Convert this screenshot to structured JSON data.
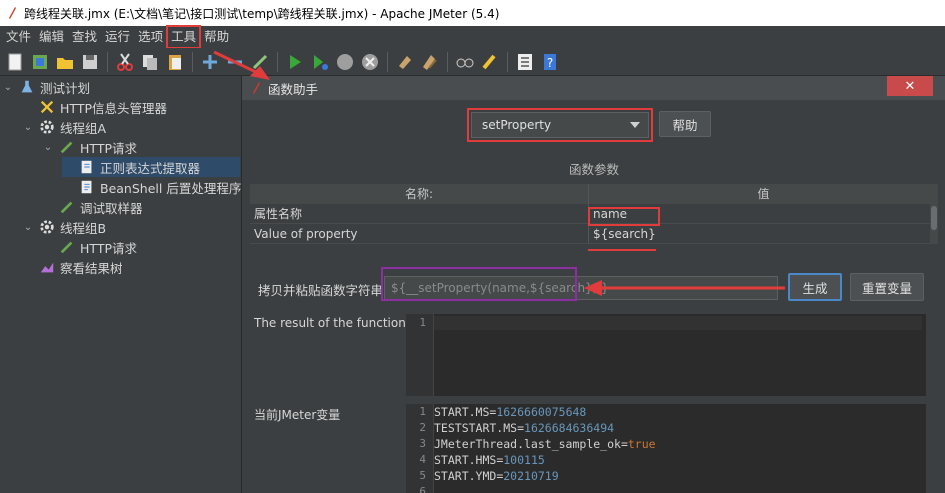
{
  "window": {
    "title": "跨线程关联.jmx (E:\\文档\\笔记\\接口测试\\temp\\跨线程关联.jmx) - Apache JMeter (5.4)"
  },
  "menu": [
    "文件",
    "编辑",
    "查找",
    "运行",
    "选项",
    "工具",
    "帮助"
  ],
  "toolbar_icons": [
    "new-icon",
    "templates-icon",
    "open-icon",
    "save-icon",
    "cut-icon",
    "copy-icon",
    "paste-icon",
    "expand-icon",
    "collapse-icon",
    "toggle-icon",
    "start-icon",
    "start-no-pause-icon",
    "stop-icon",
    "shutdown-icon",
    "clear-icon",
    "clear-all-icon",
    "search-icon",
    "reset-search-icon",
    "function-helper-icon",
    "help-icon"
  ],
  "tree": [
    {
      "label": "测试计划",
      "icon": "flask-icon",
      "level": 0,
      "expanded": true
    },
    {
      "label": "HTTP信息头管理器",
      "icon": "wrench-icon",
      "level": 1
    },
    {
      "label": "线程组A",
      "icon": "gear-icon",
      "level": 1,
      "expanded": true
    },
    {
      "label": "HTTP请求",
      "icon": "pen-icon",
      "level": 2,
      "expanded": true
    },
    {
      "label": "正则表达式提取器",
      "icon": "extractor-icon",
      "level": 3,
      "selected": true
    },
    {
      "label": "BeanShell 后置处理程序",
      "icon": "script-icon",
      "level": 3
    },
    {
      "label": "调试取样器",
      "icon": "pen-icon",
      "level": 2
    },
    {
      "label": "线程组B",
      "icon": "gear-icon",
      "level": 1,
      "expanded": true
    },
    {
      "label": "HTTP请求",
      "icon": "pen-icon",
      "level": 2
    },
    {
      "label": "察看结果树",
      "icon": "chart-icon",
      "level": 1
    }
  ],
  "dialog": {
    "title": "函数助手",
    "close_glyph": "✕",
    "function_select": "setProperty",
    "help_button": "帮助",
    "params_title": "函数参数",
    "table": {
      "headers": [
        "名称:",
        "值"
      ],
      "rows": [
        {
          "name": "属性名称",
          "value": "name"
        },
        {
          "name": "Value of property",
          "value": "${search}"
        }
      ]
    },
    "copy_label": "拷贝并粘贴函数字符串",
    "copy_value": "${__setProperty(name,${search},)}",
    "generate_button": "生成",
    "reset_button": "重置变量",
    "result_label": "The result of the function is",
    "result_line_numbers": [
      "1"
    ],
    "vars_label": "当前JMeter变量",
    "vars_line_numbers": [
      "1",
      "2",
      "3",
      "4",
      "5",
      "6"
    ],
    "vars": [
      {
        "key": "START.MS",
        "value": "1626660075648",
        "vtype": "num"
      },
      {
        "key": "TESTSTART.MS",
        "value": "1626684636494",
        "vtype": "num"
      },
      {
        "key": "JMeterThread.last_sample_ok",
        "value": "true",
        "vtype": "bool"
      },
      {
        "key": "START.HMS",
        "value": "100115",
        "vtype": "num"
      },
      {
        "key": "START.YMD",
        "value": "20210719",
        "vtype": "num"
      }
    ]
  },
  "colors": {
    "annotation_red": "#e23b3b",
    "annotation_purple": "#8c2fa0",
    "selection": "#2f4b6a",
    "background": "#3c3f41"
  }
}
